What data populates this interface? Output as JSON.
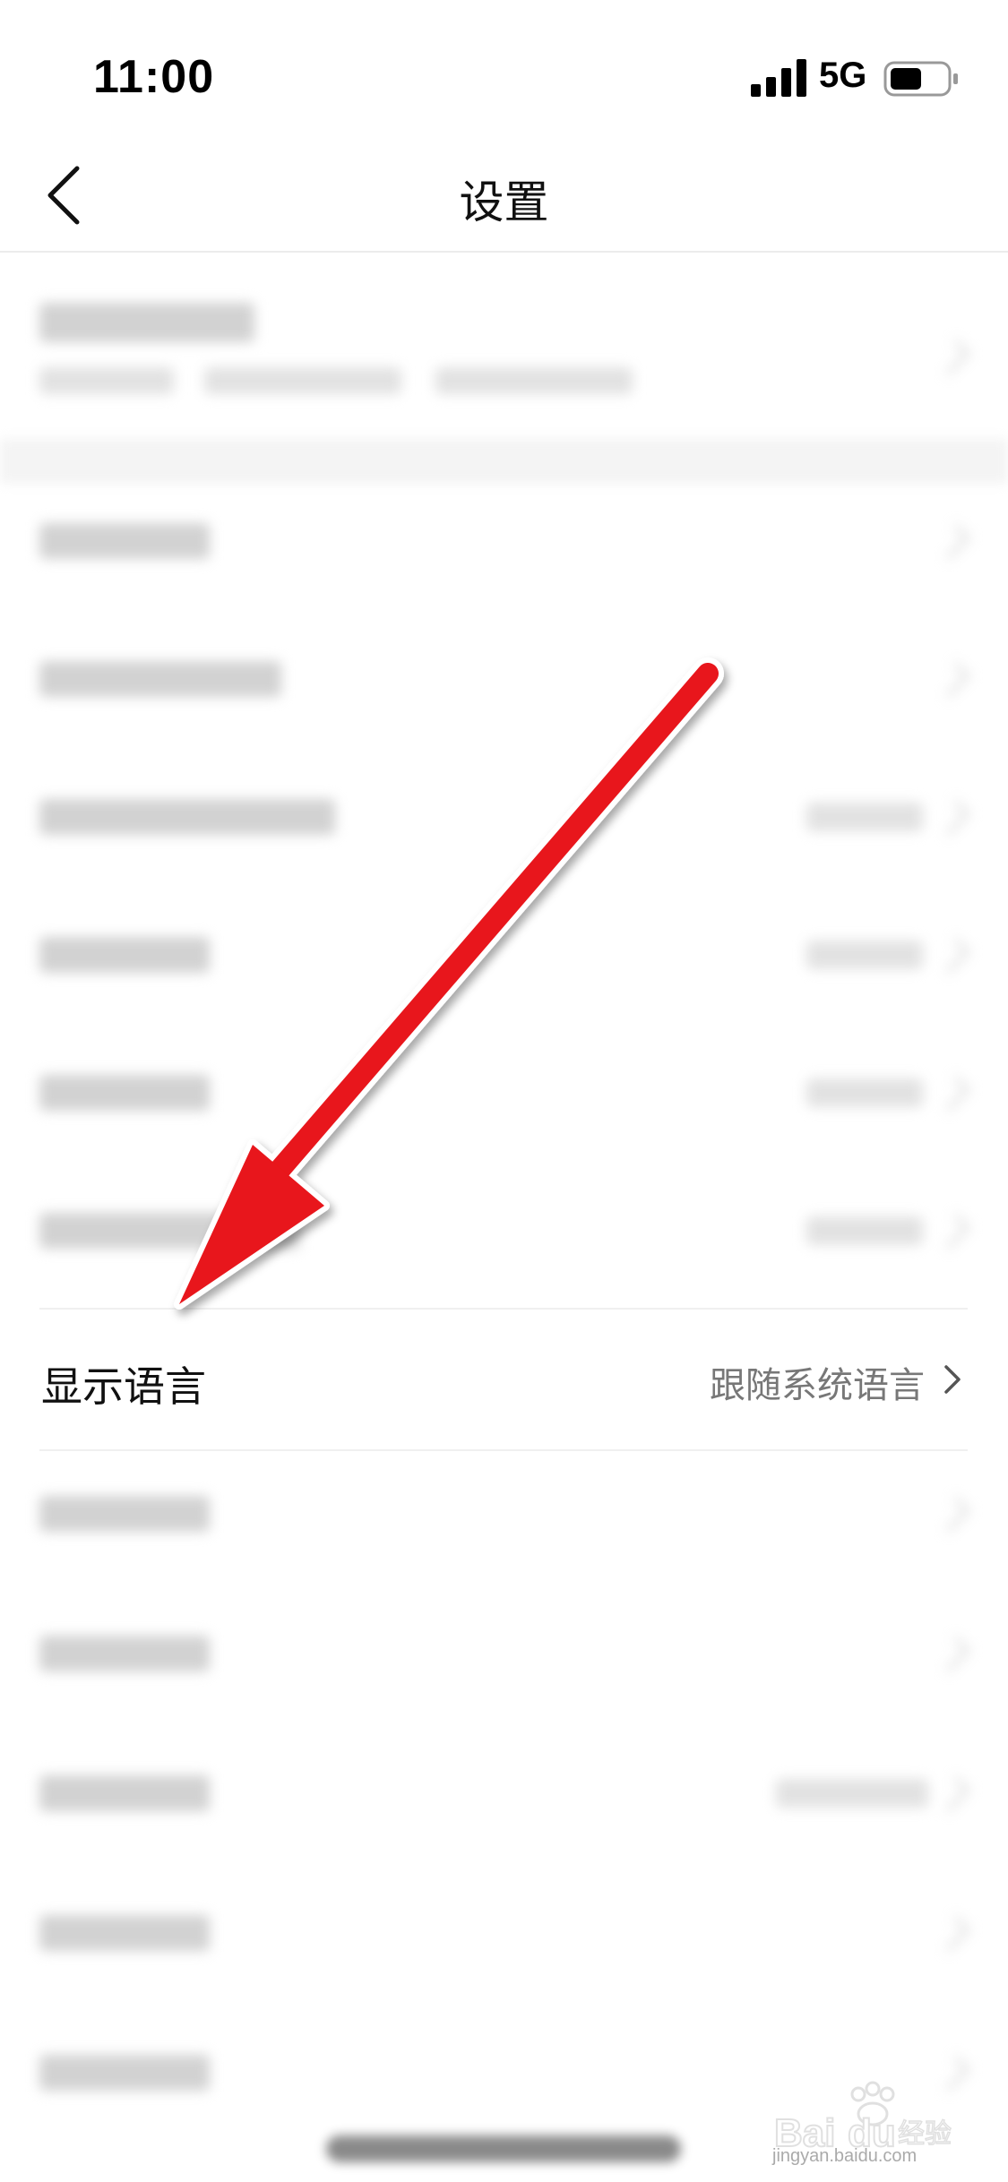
{
  "status_bar": {
    "time": "11:00",
    "network": "5G",
    "signal_icon": "signal-bars-icon",
    "battery_icon": "battery-icon"
  },
  "nav": {
    "title": "设置",
    "back_icon": "chevron-left-icon"
  },
  "settings": {
    "language_row": {
      "label": "显示语言",
      "value": "跟随系统语言",
      "chevron_icon": "chevron-right-icon"
    }
  },
  "annotation": {
    "arrow_color": "#e8141a",
    "arrow_icon": "arrow-pointer-icon"
  },
  "watermark": {
    "brand": "Bai du 经验",
    "url": "jingyan.baidu.com"
  }
}
